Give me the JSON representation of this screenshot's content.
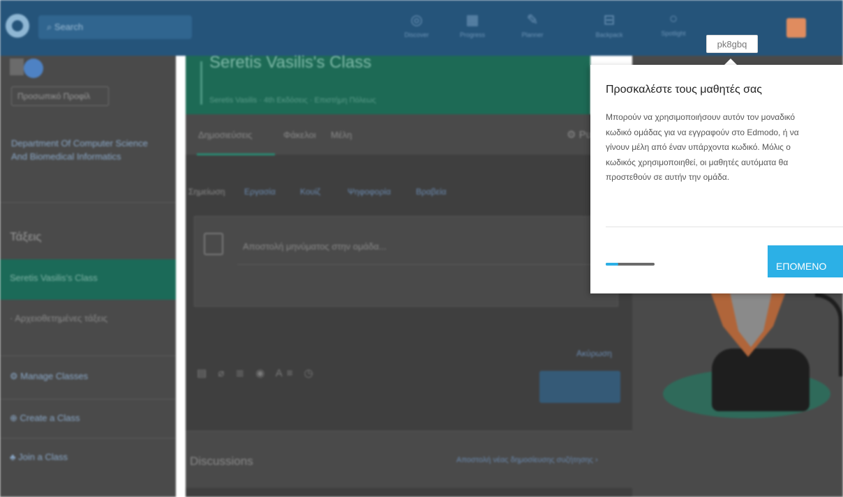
{
  "nav": {
    "search_placeholder": "Search",
    "icons": [
      "discover-icon",
      "progress-icon",
      "planner-icon",
      "backpack-icon",
      "spotlight-icon"
    ],
    "icon_captions": [
      "Discover",
      "Progress",
      "Planner",
      "Backpack",
      "Spotlight"
    ]
  },
  "sidebar": {
    "profile_button": "Προσωπικό Προφίλ",
    "department": "Department Of Computer Science And Biomedical Informatics",
    "classes_title": "Τάξεις",
    "active_class": "Seretis Vasilis's Class",
    "items": [
      {
        "label": "Αρχειοθετημένες τάξεις",
        "icon": "archive-icon"
      },
      {
        "label": "Manage Classes",
        "icon": "gear-icon"
      },
      {
        "label": "Create a Class",
        "icon": "plus-circle-icon"
      },
      {
        "label": "Join a Class",
        "icon": "join-icon"
      }
    ]
  },
  "class_header": {
    "title": "Seretis Vasilis's Class",
    "subtitle": "Seretis Vasilis · 4th Εκδόσεις · Επιστήμη Πόλεως"
  },
  "tabs": {
    "items": [
      "Δημοσιεύσεις",
      "Φάκελοι",
      "Μέλη"
    ],
    "right_label": "Ρυθμίσεις"
  },
  "filters": {
    "items": [
      "Σημείωση",
      "Εργασία",
      "Κουίζ",
      "Ψηφοφορία",
      "Βραβεία"
    ]
  },
  "composer": {
    "placeholder": "Αποστολή μηνύματος στην ομάδα...",
    "right_link": "Ακύρωση",
    "tool_icons": "▤ ⌀ ≣ ◉ A≡ ◷"
  },
  "discussions": {
    "title": "Discussions",
    "link": "Αποστολή νέας δημοσίευσης συζήτησης ›"
  },
  "popover": {
    "code": "pk8gbq",
    "title": "Προσκαλέστε τους μαθητές σας",
    "body_lines": [
      "Μπορούν να χρησιμοποιήσουν αυτόν τον μοναδικό",
      "κωδικό ομάδας για να εγγραφούν στο Edmodo, ή να",
      "γίνουν μέλη από έναν υπάρχοντα κωδικό. Μόλις ο",
      "κωδικός χρησιμοποιηθεί, οι μαθητές αυτόματα θα",
      "προστεθούν σε αυτήν την ομάδα."
    ],
    "progress": 0.25,
    "next_button": "ΕΠΟΜΕΝΟ",
    "accent": "#2cb0e6"
  }
}
